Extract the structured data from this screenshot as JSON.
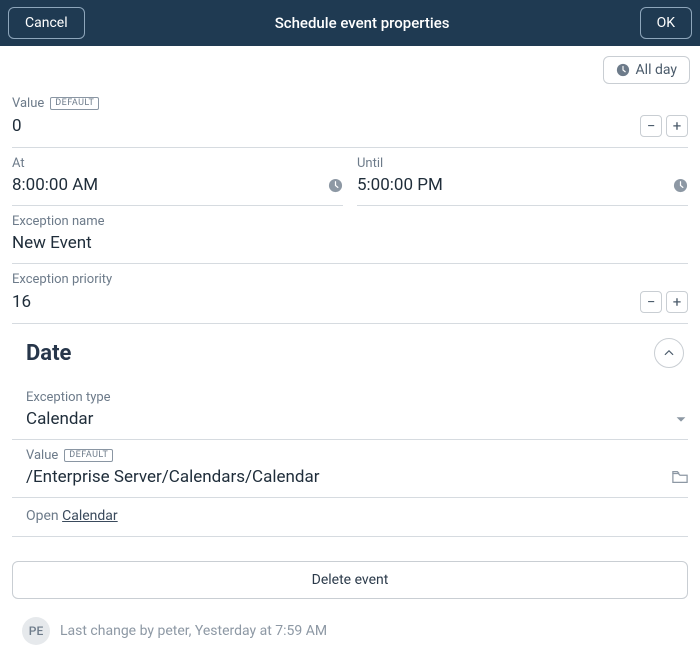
{
  "header": {
    "cancel": "Cancel",
    "title": "Schedule event properties",
    "ok": "OK"
  },
  "all_day_label": "All day",
  "fields": {
    "value1": {
      "label": "Value",
      "badge": "DEFAULT",
      "value": "0"
    },
    "at": {
      "label": "At",
      "value": "8:00:00 AM"
    },
    "until": {
      "label": "Until",
      "value": "5:00:00 PM"
    },
    "exception_name": {
      "label": "Exception name",
      "value": "New Event"
    },
    "exception_priority": {
      "label": "Exception priority",
      "value": "16"
    }
  },
  "section": {
    "title": "Date"
  },
  "date": {
    "exception_type": {
      "label": "Exception type",
      "value": "Calendar"
    },
    "value": {
      "label": "Value",
      "badge": "DEFAULT",
      "value": "/Enterprise Server/Calendars/Calendar"
    },
    "open_prefix": "Open ",
    "open_link": "Calendar"
  },
  "delete_label": "Delete event",
  "footer": {
    "avatar": "PE",
    "text": "Last change by peter, Yesterday at 7:59 AM"
  }
}
